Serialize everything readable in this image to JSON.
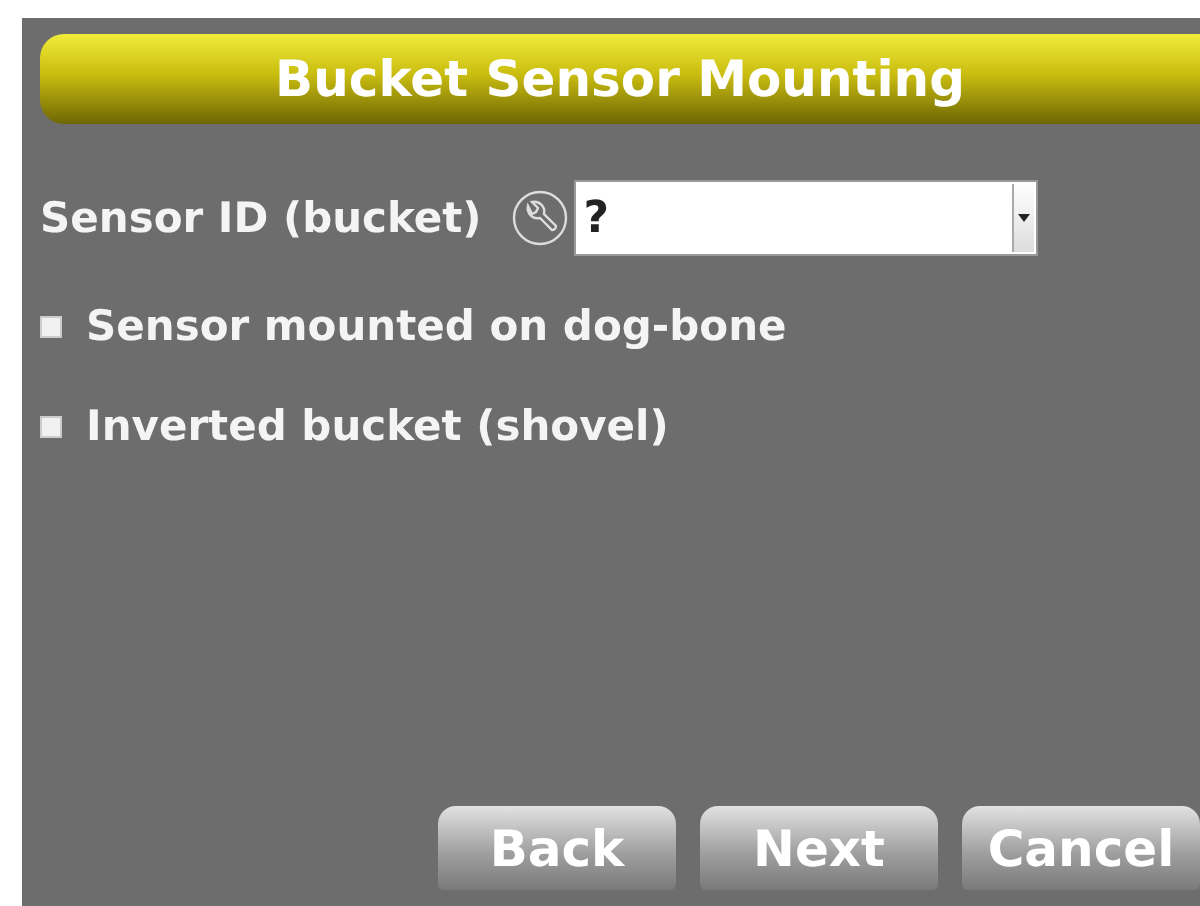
{
  "title": "Bucket Sensor Mounting",
  "sensor": {
    "label": "Sensor ID (bucket)",
    "value": "?"
  },
  "options": [
    {
      "label": "Sensor mounted on dog-bone",
      "checked": false
    },
    {
      "label": "Inverted bucket (shovel)",
      "checked": false
    }
  ],
  "buttons": [
    "Back",
    "Next",
    "Cancel"
  ]
}
